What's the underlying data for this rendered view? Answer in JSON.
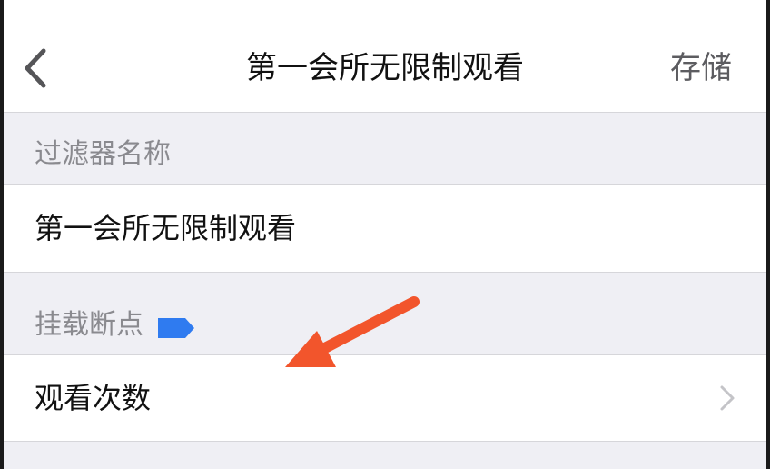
{
  "navbar": {
    "back_icon": "chevron-left-icon",
    "title": "第一会所无限制观看",
    "save_label": "存储"
  },
  "sections": {
    "filter_name": {
      "header": "过滤器名称",
      "value": "第一会所无限制观看"
    },
    "mount_breakpoint": {
      "header": "挂载断点",
      "tag_icon": "tag-icon",
      "tag_color": "#2f7bf0",
      "item_label": "观看次数",
      "item_icon": "chevron-right-icon"
    }
  },
  "annotation": {
    "arrow_color": "#f2552c",
    "arrow_icon": "arrow-pointer"
  }
}
